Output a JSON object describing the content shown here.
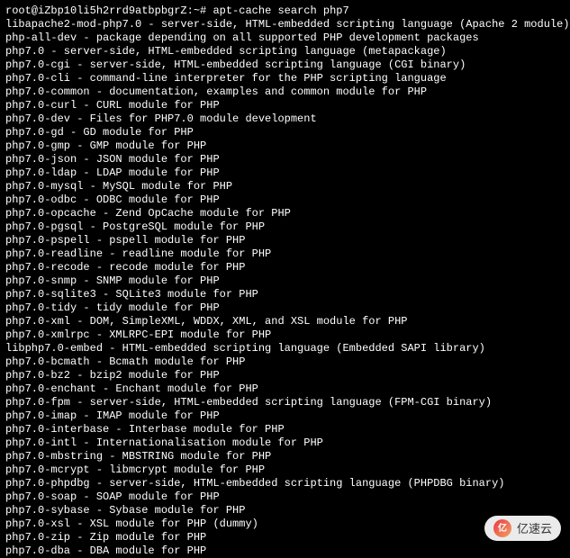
{
  "prompt": {
    "user_host": "root@iZbp10li5h2rrd9atbpbgrZ",
    "path": "~",
    "symbol": "#",
    "command": "apt-cache search php7"
  },
  "output_lines": [
    "libapache2-mod-php7.0 - server-side, HTML-embedded scripting language (Apache 2 module)",
    "php-all-dev - package depending on all supported PHP development packages",
    "php7.0 - server-side, HTML-embedded scripting language (metapackage)",
    "php7.0-cgi - server-side, HTML-embedded scripting language (CGI binary)",
    "php7.0-cli - command-line interpreter for the PHP scripting language",
    "php7.0-common - documentation, examples and common module for PHP",
    "php7.0-curl - CURL module for PHP",
    "php7.0-dev - Files for PHP7.0 module development",
    "php7.0-gd - GD module for PHP",
    "php7.0-gmp - GMP module for PHP",
    "php7.0-json - JSON module for PHP",
    "php7.0-ldap - LDAP module for PHP",
    "php7.0-mysql - MySQL module for PHP",
    "php7.0-odbc - ODBC module for PHP",
    "php7.0-opcache - Zend OpCache module for PHP",
    "php7.0-pgsql - PostgreSQL module for PHP",
    "php7.0-pspell - pspell module for PHP",
    "php7.0-readline - readline module for PHP",
    "php7.0-recode - recode module for PHP",
    "php7.0-snmp - SNMP module for PHP",
    "php7.0-sqlite3 - SQLite3 module for PHP",
    "php7.0-tidy - tidy module for PHP",
    "php7.0-xml - DOM, SimpleXML, WDDX, XML, and XSL module for PHP",
    "php7.0-xmlrpc - XMLRPC-EPI module for PHP",
    "libphp7.0-embed - HTML-embedded scripting language (Embedded SAPI library)",
    "php7.0-bcmath - Bcmath module for PHP",
    "php7.0-bz2 - bzip2 module for PHP",
    "php7.0-enchant - Enchant module for PHP",
    "php7.0-fpm - server-side, HTML-embedded scripting language (FPM-CGI binary)",
    "php7.0-imap - IMAP module for PHP",
    "php7.0-interbase - Interbase module for PHP",
    "php7.0-intl - Internationalisation module for PHP",
    "php7.0-mbstring - MBSTRING module for PHP",
    "php7.0-mcrypt - libmcrypt module for PHP",
    "php7.0-phpdbg - server-side, HTML-embedded scripting language (PHPDBG binary)",
    "php7.0-soap - SOAP module for PHP",
    "php7.0-sybase - Sybase module for PHP",
    "php7.0-xsl - XSL module for PHP (dummy)",
    "php7.0-zip - Zip module for PHP",
    "php7.0-dba - DBA module for PHP"
  ],
  "watermark": {
    "text": "亿速云",
    "icon_text": "亿"
  }
}
